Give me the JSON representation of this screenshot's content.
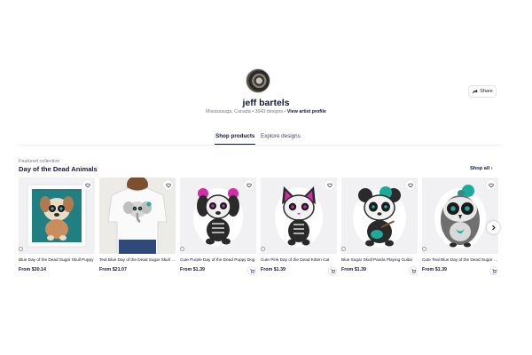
{
  "artist": {
    "name": "jeff bartels",
    "location": "Mississauga, Canada",
    "designs": "3643 designs",
    "separator": "•",
    "profile_link": "View artist profile"
  },
  "share_label": "Share",
  "tabs": [
    {
      "label": "Shop products",
      "active": true
    },
    {
      "label": "Explore designs",
      "active": false
    }
  ],
  "collection": {
    "label": "Featured collection",
    "title": "Day of the Dead Animals",
    "shop_all": "Shop all"
  },
  "products": [
    {
      "title": "Blue Day of the Dead Sugar Skull Puppy",
      "price": "From $30.14",
      "image": "framed-print-puppy",
      "cart": false
    },
    {
      "title": "Teal Blue Day of the Dead Sugar Skull Elephant",
      "price": "From $21.07",
      "image": "t-shirt-elephant",
      "cart": false
    },
    {
      "title": "Cute Purple Day of the Dead Puppy Dog",
      "price": "From $1.39",
      "image": "sticker-puppy",
      "cart": true
    },
    {
      "title": "Cute Pink Day of the Dead Kitten Cat",
      "price": "From $1.39",
      "image": "sticker-kitten",
      "cart": true
    },
    {
      "title": "Blue Sugar Skull Panda Playing Guitar",
      "price": "From $1.39",
      "image": "sticker-panda",
      "cart": true
    },
    {
      "title": "Cute Teal Blue Day of the Dead Sugar Skull Owl",
      "price": "From $1.39",
      "image": "sticker-owl",
      "cart": true
    }
  ],
  "colors": {
    "text_primary": "#15173a",
    "text_secondary": "#7a7a86",
    "accent_teal": "#1fa99a",
    "accent_pink": "#d62aa8"
  }
}
